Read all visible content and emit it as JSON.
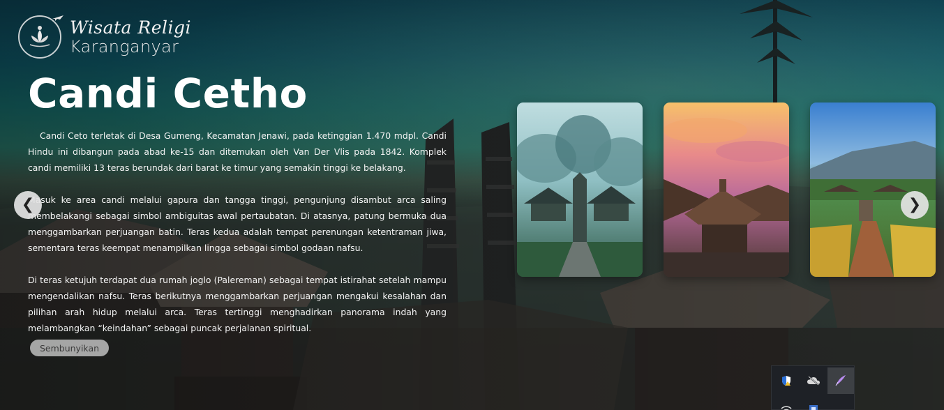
{
  "logo": {
    "line1": "Wisata Religi",
    "line2": "Karanganyar",
    "icon": "lotus-plane-icon"
  },
  "main": {
    "title": "Candi Cetho",
    "paragraphs": [
      "Candi Ceto terletak di Desa Gumeng, Kecamatan Jenawi, pada ketinggian 1.470 mdpl. Candi Hindu ini dibangun pada abad ke-15 dan ditemukan oleh Van Der Vlis pada 1842. Komplek candi memiliki 13 teras berundak dari barat ke timur yang semakin tinggi ke belakang.",
      "Masuk ke area candi melalui gapura dan tangga tinggi, pengunjung disambut arca saling membelakangi sebagai simbol ambiguitas awal pertaubatan. Di atasnya, patung bermuka dua menggambarkan perjuangan batin. Teras kedua adalah tempat perenungan ketentraman jiwa, sementara teras keempat menampilkan lingga sebagai simbol godaan nafsu.",
      "Di teras ketujuh terdapat dua rumah joglo (Palereman) sebagai tempat istirahat setelah mampu mengendalikan nafsu. Teras berikutnya menggambarkan perjuangan mengakui kesalahan dan pilihan arah hidup melalui arca. Teras tertinggi menghadirkan panorama indah yang melambangkan “keindahan” sebagai puncak perjalanan spiritual."
    ],
    "hide_button": "Sembunyikan"
  },
  "carousel": {
    "prev_label": "❮",
    "next_label": "❯",
    "cards": [
      {
        "name": "misty-temple-photo"
      },
      {
        "name": "sunset-pavilion-photo"
      },
      {
        "name": "mountain-terrace-photo"
      }
    ]
  },
  "tray": {
    "icons": [
      "shield-warning-icon",
      "cloud-offline-icon",
      "pen-icon",
      "wifi-icon",
      "app-icon"
    ]
  },
  "colors": {
    "hide_button_bg": "#bebebe",
    "nav_button_bg": "#e4e4e4",
    "tray_bg": "#1e2126"
  }
}
